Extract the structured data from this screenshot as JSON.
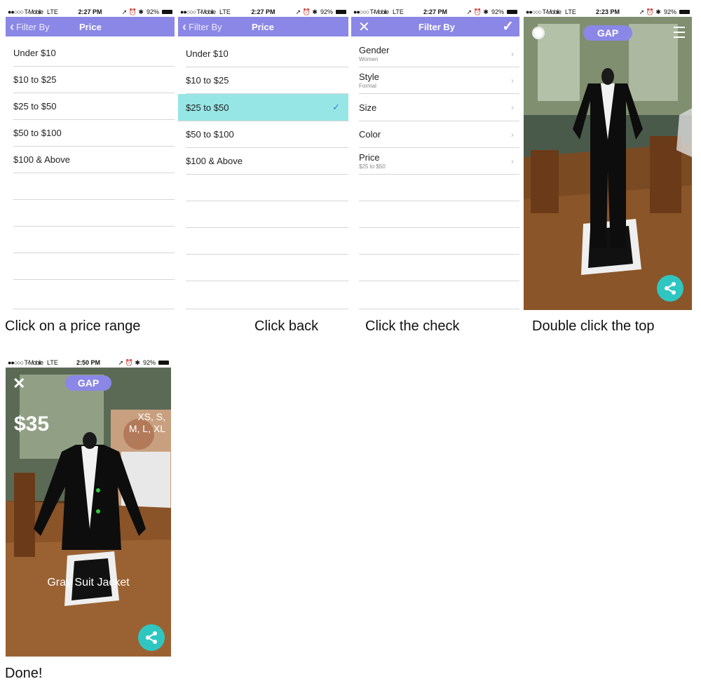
{
  "status": {
    "carrier": "●●○○○ T-Mobile",
    "network": "LTE",
    "battery": "92%",
    "right_icons": "➚ ⏰ ✱"
  },
  "screen1": {
    "time": "2:27 PM",
    "back_label": "Filter By",
    "title": "Price",
    "rows": [
      "Under $10",
      "$10 to $25",
      "$25 to $50",
      "$50 to $100",
      "$100 & Above"
    ]
  },
  "screen2": {
    "time": "2:27 PM",
    "back_label": "Filter By",
    "title": "Price",
    "rows": [
      "Under $10",
      "$10 to $25",
      "$25 to $50",
      "$50 to $100",
      "$100 & Above"
    ],
    "selected_index": 2
  },
  "screen3": {
    "time": "2:27 PM",
    "title": "Filter By",
    "rows": [
      {
        "label": "Gender",
        "sub": "Women"
      },
      {
        "label": "Style",
        "sub": "Formal"
      },
      {
        "label": "Size",
        "sub": ""
      },
      {
        "label": "Color",
        "sub": ""
      },
      {
        "label": "Price",
        "sub": "$25 to $50"
      }
    ]
  },
  "screen4": {
    "time": "2:23 PM",
    "brand": "GAP"
  },
  "screen5": {
    "time": "2:50 PM",
    "brand": "GAP",
    "price": "$35",
    "sizes_line1": "XS, S,",
    "sizes_line2": "M, L, XL",
    "product_name": "Gray Suit Jacket"
  },
  "captions": {
    "c1": "Click on a price range",
    "c2": "Click back",
    "c3": "Click the check",
    "c4": "Double click the top",
    "c5": "Done!"
  },
  "colors": {
    "accent": "#8b87e6",
    "selected_row": "#97e6e6",
    "share": "#2fc6c2"
  }
}
